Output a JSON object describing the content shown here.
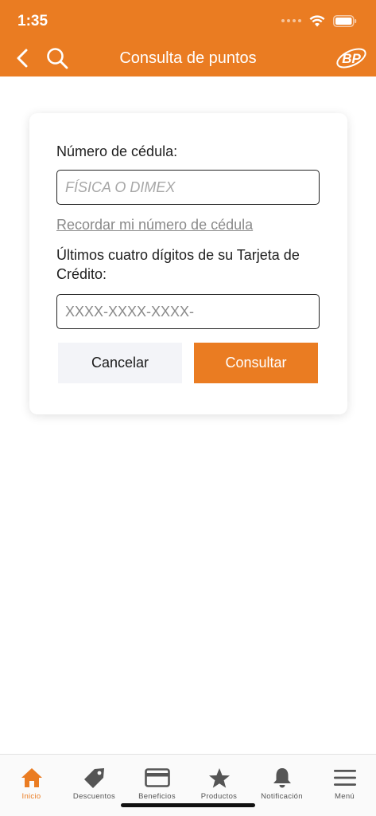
{
  "status": {
    "time": "1:35"
  },
  "nav": {
    "title": "Consulta de puntos",
    "logo_text": "BP"
  },
  "form": {
    "cedula_label": "Número de cédula:",
    "cedula_placeholder": "FÍSICA O DIMEX",
    "remember_link": "Recordar mi número de cédula",
    "card_label": "Últimos cuatro dígitos de su Tarjeta de Crédito:",
    "card_placeholder": "XXXX-XXXX-XXXX-",
    "cancel_label": "Cancelar",
    "submit_label": "Consultar"
  },
  "tabbar": {
    "items": [
      {
        "label": "Inicio",
        "icon": "home-icon",
        "active": true
      },
      {
        "label": "Descuentos",
        "icon": "tag-icon",
        "active": false
      },
      {
        "label": "Beneficios",
        "icon": "credit-card-icon",
        "active": false
      },
      {
        "label": "Productos",
        "icon": "star-icon",
        "active": false
      },
      {
        "label": "Notificación",
        "icon": "bell-icon",
        "active": false
      },
      {
        "label": "Menú",
        "icon": "hamburger-menu-icon",
        "active": false
      }
    ]
  },
  "colors": {
    "accent": "#ea7c22",
    "cancel_bg": "#f3f4f8",
    "icon_gray": "#555555"
  }
}
